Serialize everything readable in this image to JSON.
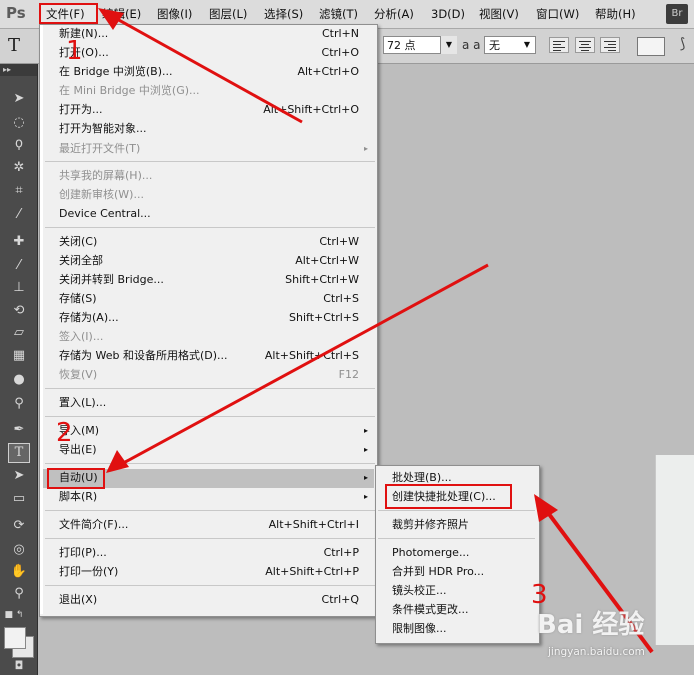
{
  "menubar": {
    "logo": "Ps",
    "items": [
      "文件(F)",
      "编辑(E)",
      "图像(I)",
      "图层(L)",
      "选择(S)",
      "滤镜(T)",
      "分析(A)",
      "3D(D)",
      "视图(V)",
      "窗口(W)",
      "帮助(H)"
    ],
    "bridge_label": "Br"
  },
  "optionsbar": {
    "tool_glyph": "T",
    "font_size": "72 点",
    "aa_label": "a a",
    "aa_value": "无",
    "warp_glyph": "⟆"
  },
  "file_menu": {
    "items": [
      {
        "label": "新建(N)...",
        "shortcut": "Ctrl+N",
        "disabled": false
      },
      {
        "label": "打开(O)...",
        "shortcut": "Ctrl+O",
        "disabled": false
      },
      {
        "label": "在 Bridge 中浏览(B)...",
        "shortcut": "Alt+Ctrl+O",
        "disabled": false
      },
      {
        "label": "在 Mini Bridge 中浏览(G)...",
        "shortcut": "",
        "disabled": true
      },
      {
        "label": "打开为...",
        "shortcut": "Alt+Shift+Ctrl+O",
        "disabled": false
      },
      {
        "label": "打开为智能对象...",
        "shortcut": "",
        "disabled": false
      },
      {
        "label": "最近打开文件(T)",
        "shortcut": "",
        "disabled": true,
        "submenu": true
      },
      {
        "label": "共享我的屏幕(H)...",
        "shortcut": "",
        "disabled": true
      },
      {
        "label": "创建新审核(W)...",
        "shortcut": "",
        "disabled": true
      },
      {
        "label": "Device Central...",
        "shortcut": "",
        "disabled": false
      },
      {
        "label": "关闭(C)",
        "shortcut": "Ctrl+W",
        "disabled": false
      },
      {
        "label": "关闭全部",
        "shortcut": "Alt+Ctrl+W",
        "disabled": false
      },
      {
        "label": "关闭并转到 Bridge...",
        "shortcut": "Shift+Ctrl+W",
        "disabled": false
      },
      {
        "label": "存储(S)",
        "shortcut": "Ctrl+S",
        "disabled": false
      },
      {
        "label": "存储为(A)...",
        "shortcut": "Shift+Ctrl+S",
        "disabled": false
      },
      {
        "label": "签入(I)...",
        "shortcut": "",
        "disabled": true
      },
      {
        "label": "存储为 Web 和设备所用格式(D)...",
        "shortcut": "Alt+Shift+Ctrl+S",
        "disabled": false
      },
      {
        "label": "恢复(V)",
        "shortcut": "F12",
        "disabled": true
      },
      {
        "label": "置入(L)...",
        "shortcut": "",
        "disabled": false
      },
      {
        "label": "导入(M)",
        "shortcut": "",
        "disabled": false,
        "submenu": true
      },
      {
        "label": "导出(E)",
        "shortcut": "",
        "disabled": false,
        "submenu": true
      },
      {
        "label": "自动(U)",
        "shortcut": "",
        "disabled": false,
        "submenu": true,
        "highlighted": true
      },
      {
        "label": "脚本(R)",
        "shortcut": "",
        "disabled": false,
        "submenu": true
      },
      {
        "label": "文件简介(F)...",
        "shortcut": "Alt+Shift+Ctrl+I",
        "disabled": false
      },
      {
        "label": "打印(P)...",
        "shortcut": "Ctrl+P",
        "disabled": false
      },
      {
        "label": "打印一份(Y)",
        "shortcut": "Alt+Shift+Ctrl+P",
        "disabled": false
      },
      {
        "label": "退出(X)",
        "shortcut": "Ctrl+Q",
        "disabled": false
      }
    ],
    "submenu_arrow": "▸"
  },
  "automate_submenu": {
    "items": [
      "批处理(B)...",
      "创建快捷批处理(C)...",
      "裁剪并修齐照片",
      "Photomerge...",
      "合并到 HDR Pro...",
      "镜头校正...",
      "条件模式更改...",
      "限制图像..."
    ]
  },
  "annotations": {
    "step1": "1",
    "step2": "2",
    "step3": "3",
    "accent_color": "#e01010"
  },
  "watermark": {
    "brand": "Bai 经验",
    "url": "jingyan.baidu.com"
  },
  "tools": [
    "move-icon",
    "marquee-icon",
    "lasso-icon",
    "quick-select-icon",
    "crop-icon",
    "eyedropper-icon",
    "healing-icon",
    "brush-icon",
    "stamp-icon",
    "history-brush-icon",
    "eraser-icon",
    "gradient-icon",
    "blur-icon",
    "dodge-icon",
    "pen-icon",
    "text-icon",
    "path-select-icon",
    "shape-icon",
    "3d-rotate-icon",
    "3d-orbit-icon",
    "hand-icon",
    "zoom-icon"
  ]
}
